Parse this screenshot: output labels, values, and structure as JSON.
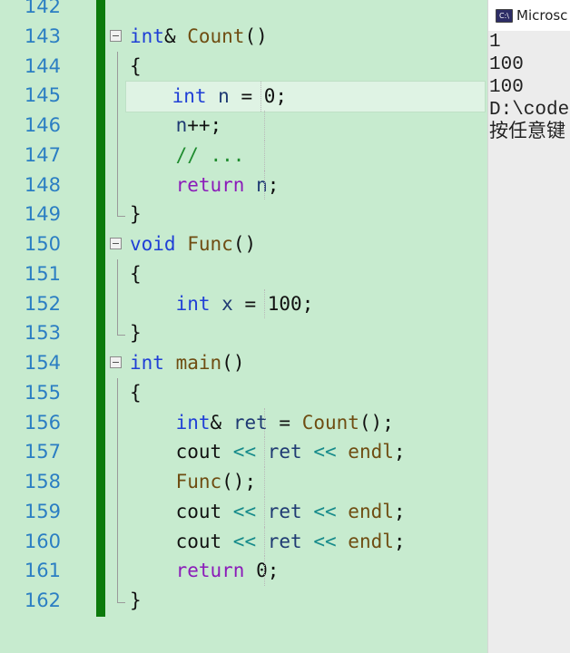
{
  "editor": {
    "lines": [
      {
        "number": "142",
        "code": ""
      },
      {
        "number": "143",
        "code": "int& Count()"
      },
      {
        "number": "144",
        "code": "{"
      },
      {
        "number": "145",
        "code": "    int n = 0;"
      },
      {
        "number": "146",
        "code": "    n++;"
      },
      {
        "number": "147",
        "code": "    // ..."
      },
      {
        "number": "148",
        "code": "    return n;"
      },
      {
        "number": "149",
        "code": "}"
      },
      {
        "number": "150",
        "code": "void Func()"
      },
      {
        "number": "151",
        "code": "{"
      },
      {
        "number": "152",
        "code": "    int x = 100;"
      },
      {
        "number": "153",
        "code": "}"
      },
      {
        "number": "154",
        "code": "int main()"
      },
      {
        "number": "155",
        "code": "{"
      },
      {
        "number": "156",
        "code": "    int& ret = Count();"
      },
      {
        "number": "157",
        "code": "    cout << ret << endl;"
      },
      {
        "number": "158",
        "code": "    Func();"
      },
      {
        "number": "159",
        "code": "    cout << ret << endl;"
      },
      {
        "number": "160",
        "code": "    cout << ret << endl;"
      },
      {
        "number": "161",
        "code": "    return 0;"
      },
      {
        "number": "162",
        "code": "}"
      }
    ],
    "colors": {
      "background": "#c7ebcf",
      "line_numbers": "#2b7ec3",
      "keyword": "#1f3fd6",
      "function": "#6f4d12",
      "variable": "#1f3a73",
      "operator": "#168a8a",
      "return_keyword": "#8b1bb9",
      "comment": "#1f8c2f",
      "change_bar": "#0c7a0c"
    }
  },
  "console": {
    "title": "Microsc",
    "icon": "console-app-icon",
    "output": [
      "1",
      "100",
      "100",
      "",
      "D:\\code",
      "按任意键"
    ]
  }
}
